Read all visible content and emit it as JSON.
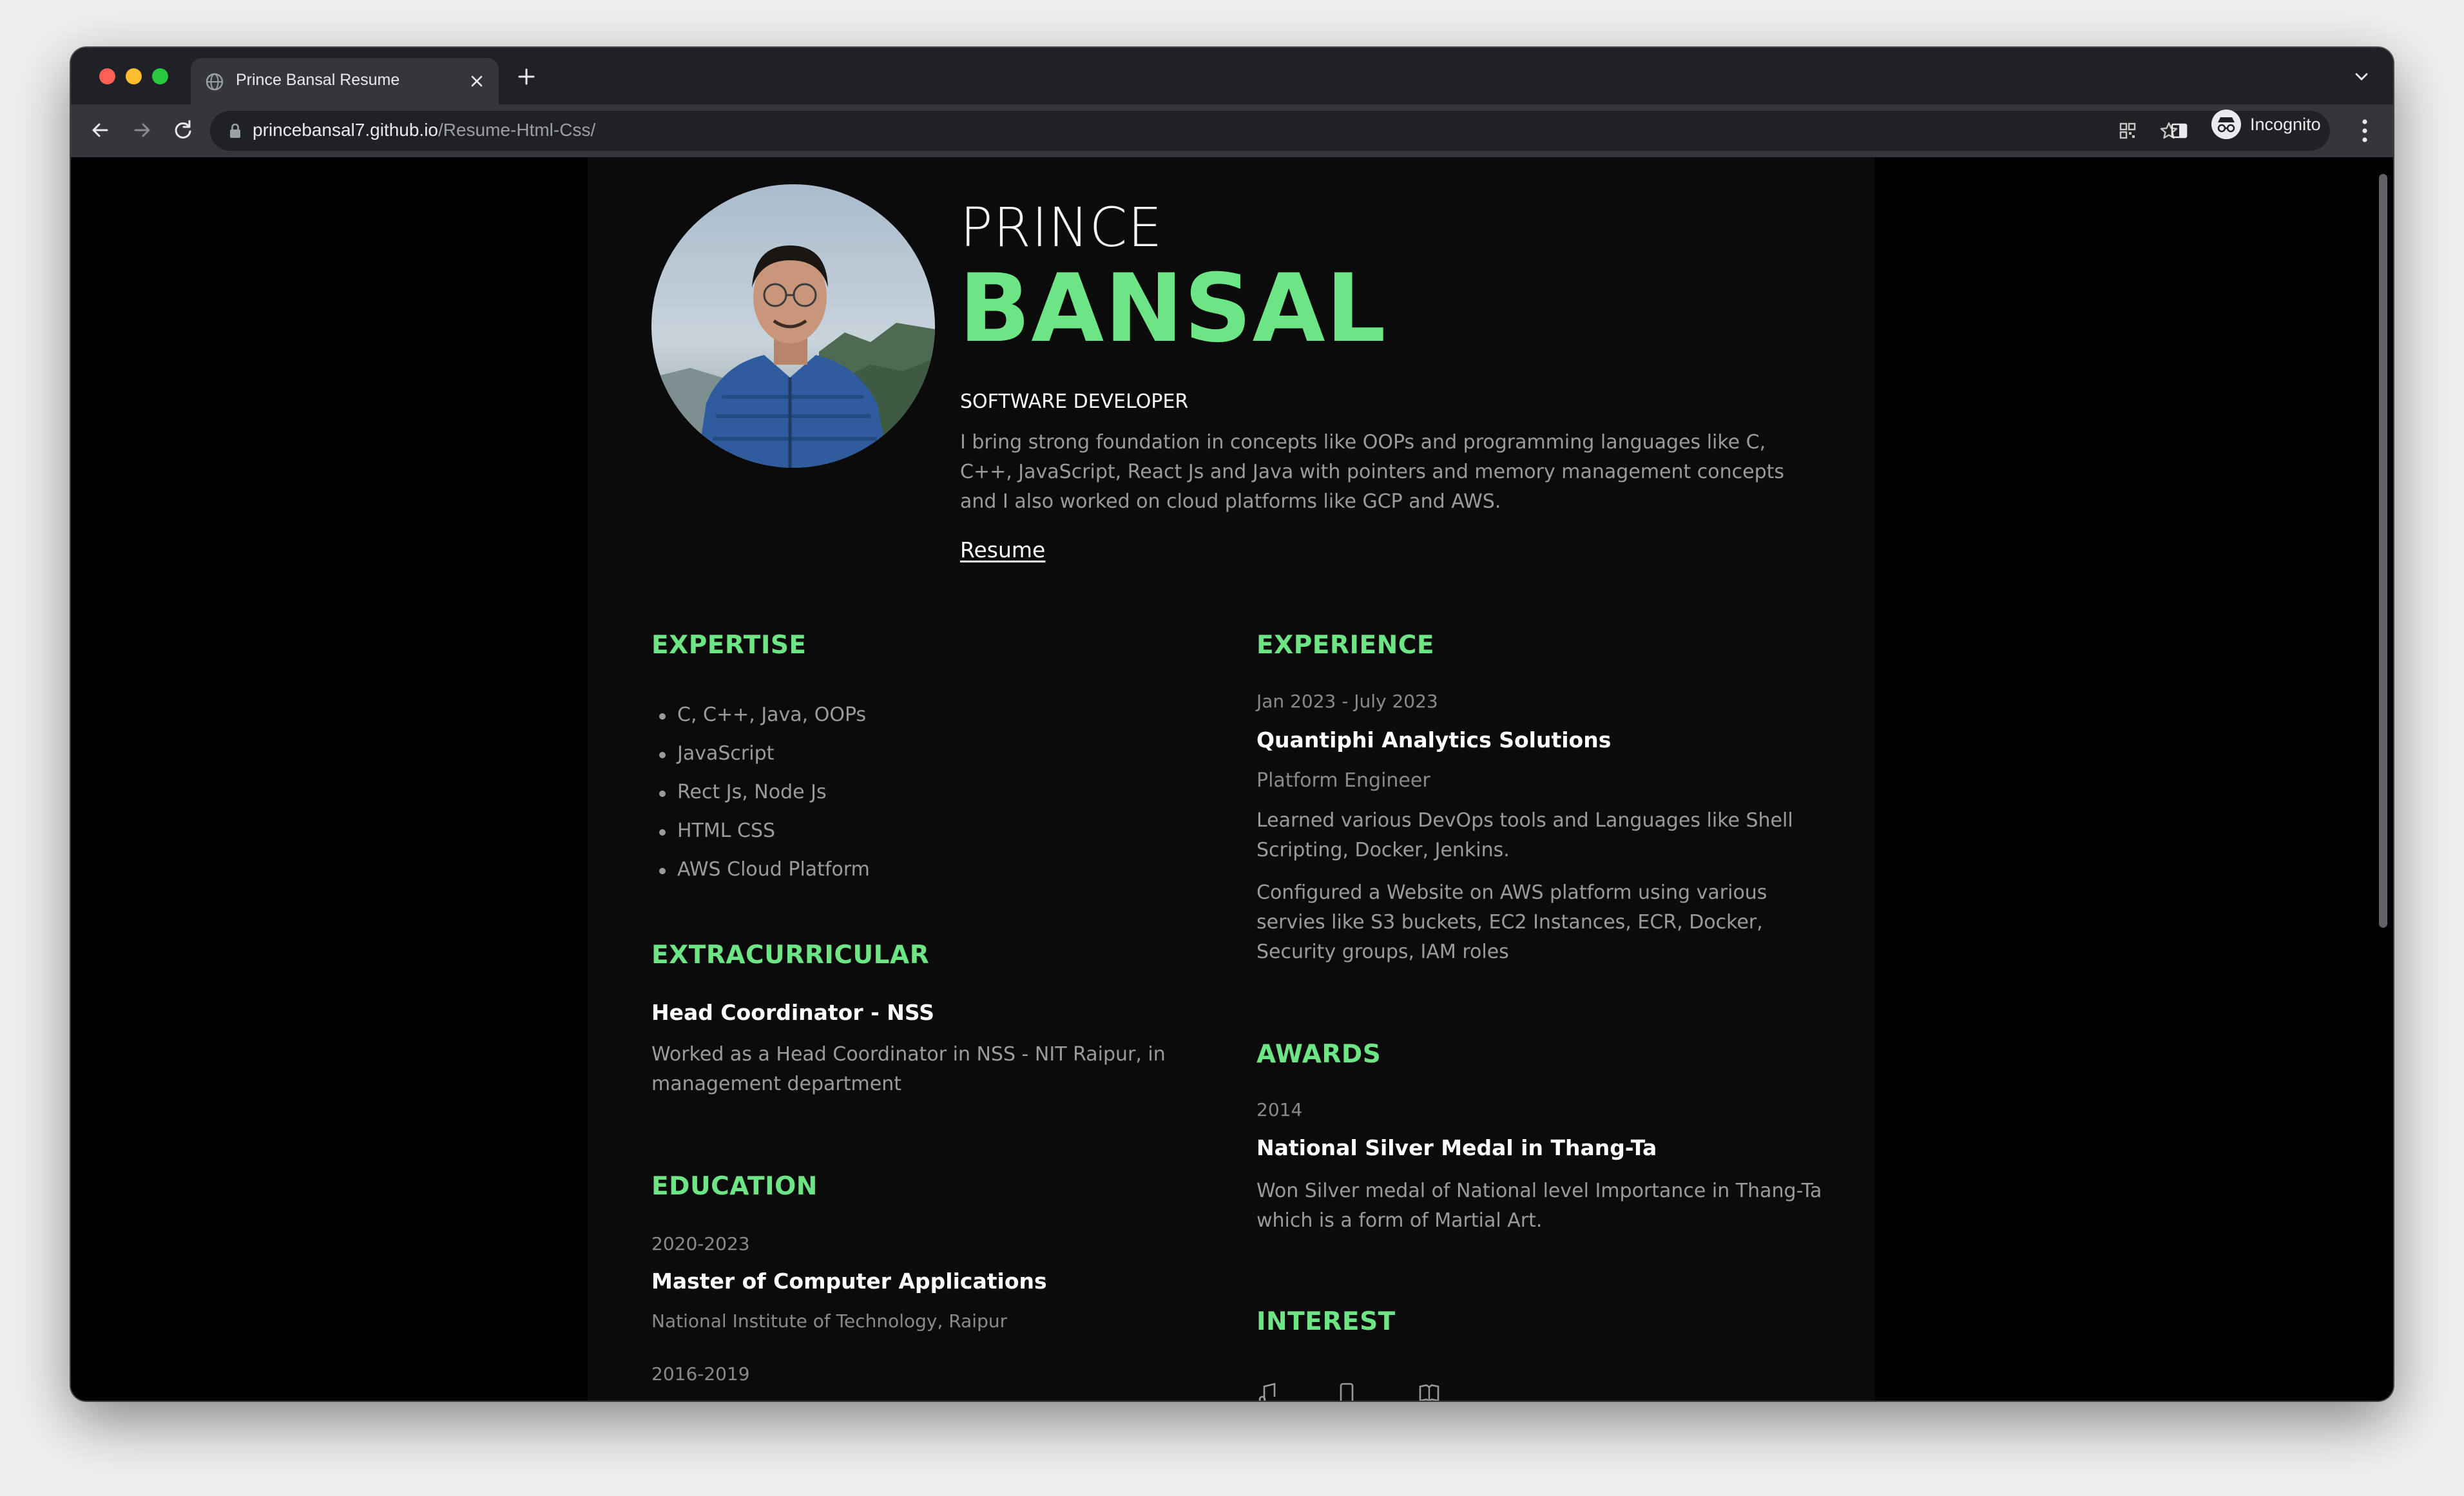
{
  "browser": {
    "tab_title": "Prince Bansal Resume",
    "url_host": "princebansal7.github.io",
    "url_path": "/Resume-Html-Css/",
    "profile_label": "Incognito"
  },
  "profile": {
    "first_name": "PRINCE",
    "last_name": "BANSAL",
    "role": "SOFTWARE DEVELOPER",
    "intro": "I bring strong foundation in concepts like OOPs and programming languages like C, C++, JavaScript, React Js and Java with pointers and memory management concepts and I also worked on cloud platforms like GCP and AWS.",
    "resume_link": "Resume"
  },
  "expertise": {
    "heading": "EXPERTISE",
    "items": [
      "C, C++, Java, OOPs",
      "JavaScript",
      "Rect Js, Node Js",
      "HTML CSS",
      "AWS Cloud Platform"
    ]
  },
  "extracurricular": {
    "heading": "EXTRACURRICULAR",
    "title": "Head Coordinator - NSS",
    "description": "Worked as a Head Coordinator in NSS - NIT Raipur, in management department"
  },
  "education": {
    "heading": "EDUCATION",
    "entries": [
      {
        "years": "2020-2023",
        "degree": "Master of Computer Applications",
        "school": "National Institute of Technology, Raipur"
      },
      {
        "years": "2016-2019"
      }
    ]
  },
  "experience": {
    "heading": "EXPERIENCE",
    "dates": "Jan 2023 - July 2023",
    "company": "Quantiphi Analytics Solutions",
    "position": "Platform Engineer",
    "points": [
      "Learned various DevOps tools and Languages like Shell Scripting, Docker, Jenkins.",
      "Configured a Website on AWS platform using various servies like S3 buckets, EC2 Instances, ECR, Docker, Security groups, IAM roles"
    ]
  },
  "awards": {
    "heading": "AWARDS",
    "year": "2014",
    "title": "National Silver Medal in Thang-Ta",
    "description": "Won Silver medal of National level Importance in Thang-Ta which is a form of Martial Art."
  },
  "interest": {
    "heading": "INTEREST",
    "icons": [
      "music-icon",
      "mobile-icon",
      "book-icon"
    ]
  },
  "colors": {
    "accent": "#6ee585",
    "page_bg": "#0b0b0c",
    "muted_text": "#9b9b9b"
  }
}
